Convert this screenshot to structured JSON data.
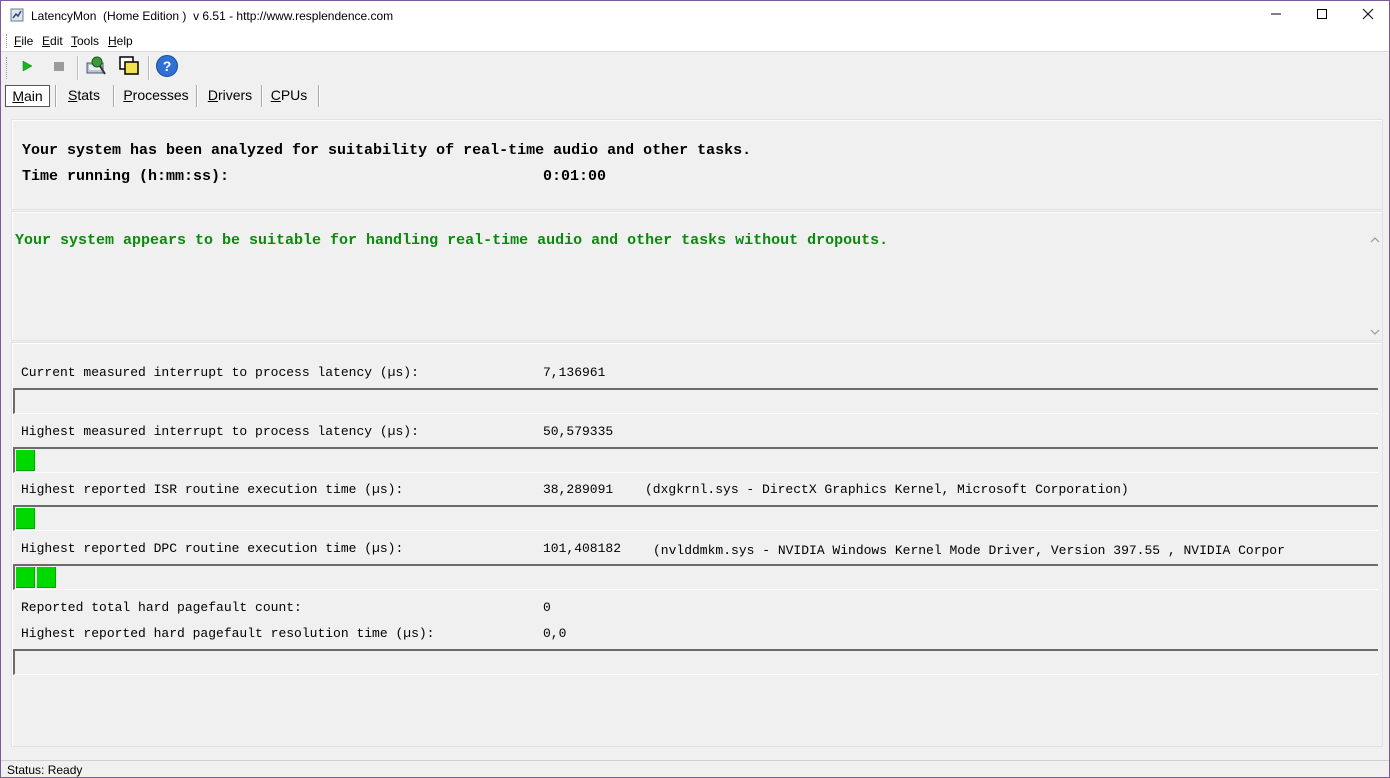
{
  "window": {
    "title": "LatencyMon  (Home Edition )  v 6.51 - http://www.resplendence.com",
    "controls": {
      "minimize_icon": "minimize-icon",
      "maximize_icon": "maximize-icon",
      "close_icon": "close-icon"
    }
  },
  "menu": {
    "items": [
      {
        "label": "File"
      },
      {
        "label": "Edit"
      },
      {
        "label": "Tools"
      },
      {
        "label": "Help"
      }
    ]
  },
  "toolbar": {
    "buttons": [
      {
        "icon": "play-icon"
      },
      {
        "icon": "stop-icon"
      },
      {
        "icon": "drivers-tool-icon"
      },
      {
        "icon": "windows-icon"
      },
      {
        "icon": "help-icon"
      }
    ]
  },
  "tabs": [
    {
      "label": "Main",
      "active": true
    },
    {
      "label": "Stats"
    },
    {
      "label": "Processes"
    },
    {
      "label": "Drivers"
    },
    {
      "label": "CPUs"
    }
  ],
  "summary": {
    "analyzed_text": "Your system has been analyzed for suitability of real-time audio and other tasks.",
    "time_running_label": "Time running (h:mm:ss):",
    "time_running_value": "0:01:00"
  },
  "verdict": {
    "message": "Your system appears to be suitable for handling real-time audio and other tasks without dropouts.",
    "color": "#0a8a0a"
  },
  "metrics": [
    {
      "label": "Current measured interrupt to process latency (µs):",
      "value": "7,136961",
      "detail": "",
      "bar_segments": 0
    },
    {
      "label": "Highest measured interrupt to process latency (µs):",
      "value": "50,579335",
      "detail": "",
      "bar_segments": 1
    },
    {
      "label": "Highest reported ISR routine execution time (µs):",
      "value": "38,289091",
      "detail": "(dxgkrnl.sys - DirectX Graphics Kernel, Microsoft Corporation)",
      "bar_segments": 1
    },
    {
      "label": "Highest reported DPC routine execution time (µs):",
      "value": "101,408182",
      "detail": "(nvlddmkm.sys - NVIDIA Windows Kernel Mode Driver, Version 397.55 , NVIDIA Corpor",
      "bar_segments": 2
    }
  ],
  "pagefault": {
    "count_label": "Reported total hard pagefault count:",
    "count_value": "0",
    "resolution_label": "Highest reported hard pagefault resolution time (µs):",
    "resolution_value": "0,0",
    "bar_segments": 0
  },
  "status": {
    "text": "Status: Ready"
  },
  "colors": {
    "bar_fill": "#00d900",
    "accent_border": "#7d5a9c"
  }
}
